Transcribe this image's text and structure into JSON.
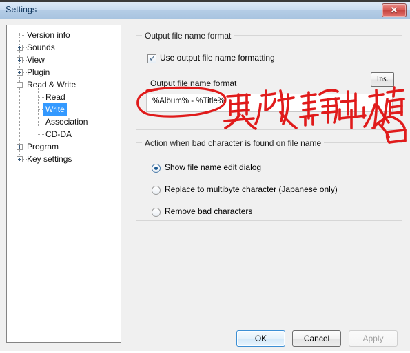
{
  "window": {
    "title": "Settings",
    "close_label": "✕"
  },
  "tree": {
    "items": [
      {
        "label": "Version info",
        "level": 0,
        "expander": "none",
        "selected": false
      },
      {
        "label": "Sounds",
        "level": 0,
        "expander": "plus",
        "selected": false
      },
      {
        "label": "View",
        "level": 0,
        "expander": "plus",
        "selected": false
      },
      {
        "label": "Plugin",
        "level": 0,
        "expander": "plus",
        "selected": false
      },
      {
        "label": "Read & Write",
        "level": 0,
        "expander": "minus",
        "selected": false
      },
      {
        "label": "Read",
        "level": 1,
        "expander": "none",
        "selected": false
      },
      {
        "label": "Write",
        "level": 1,
        "expander": "none",
        "selected": true
      },
      {
        "label": "Association",
        "level": 1,
        "expander": "none",
        "selected": false
      },
      {
        "label": "CD-DA",
        "level": 1,
        "expander": "none",
        "selected": false
      },
      {
        "label": "Program",
        "level": 0,
        "expander": "plus",
        "selected": false
      },
      {
        "label": "Key settings",
        "level": 0,
        "expander": "plus",
        "selected": false
      }
    ]
  },
  "output_format_group": {
    "title": "Output file name format",
    "use_formatting_checkbox": {
      "label": "Use output file name formatting",
      "checked": true,
      "check_glyph": "✓"
    },
    "field_label": "Output file name format",
    "insert_button": "Ins.",
    "format_input": {
      "value": "%Album% - %Title%",
      "placeholder": ""
    }
  },
  "bad_character_group": {
    "title": "Action when bad character is found on file name",
    "options": [
      {
        "label": "Show file name edit dialog",
        "selected": true
      },
      {
        "label": "Replace to multibyte character (Japanese only)",
        "selected": false
      },
      {
        "label": "Remove bad characters",
        "selected": false
      }
    ]
  },
  "footer": {
    "ok_label": "OK",
    "cancel_label": "Cancel",
    "apply_label": "Apply",
    "apply_enabled": false
  },
  "annotation": {
    "text": "更改輸出檔名",
    "color": "#e01b1b",
    "shape": "ellipse-around-format-input"
  }
}
